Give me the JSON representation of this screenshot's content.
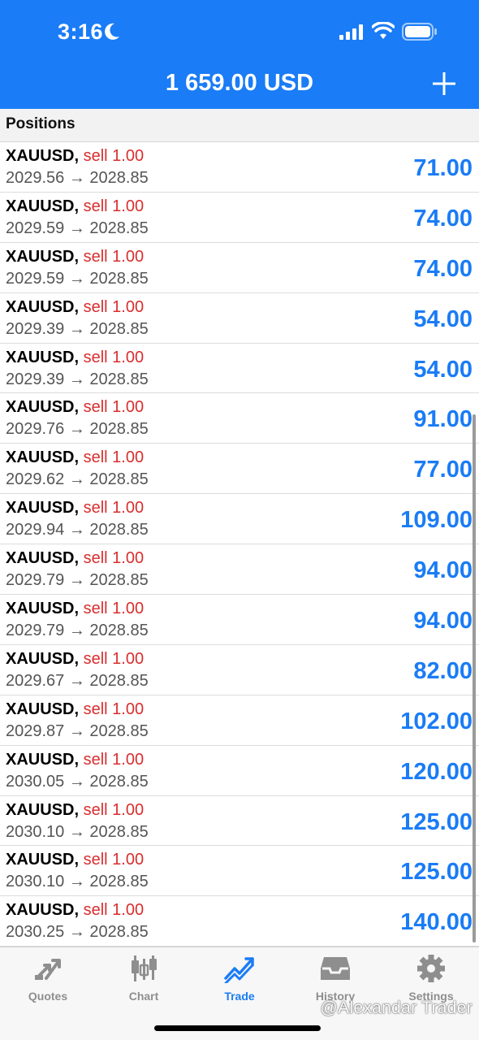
{
  "status_bar": {
    "time": "3:16"
  },
  "header": {
    "balance": "1 659.00 USD"
  },
  "section": {
    "title": "Positions"
  },
  "positions": [
    {
      "symbol": "XAUUSD,",
      "direction": "sell 1.00",
      "open_price": "2029.56",
      "current_price": "2028.85",
      "profit": "71.00"
    },
    {
      "symbol": "XAUUSD,",
      "direction": "sell 1.00",
      "open_price": "2029.59",
      "current_price": "2028.85",
      "profit": "74.00"
    },
    {
      "symbol": "XAUUSD,",
      "direction": "sell 1.00",
      "open_price": "2029.59",
      "current_price": "2028.85",
      "profit": "74.00"
    },
    {
      "symbol": "XAUUSD,",
      "direction": "sell 1.00",
      "open_price": "2029.39",
      "current_price": "2028.85",
      "profit": "54.00"
    },
    {
      "symbol": "XAUUSD,",
      "direction": "sell 1.00",
      "open_price": "2029.39",
      "current_price": "2028.85",
      "profit": "54.00"
    },
    {
      "symbol": "XAUUSD,",
      "direction": "sell 1.00",
      "open_price": "2029.76",
      "current_price": "2028.85",
      "profit": "91.00"
    },
    {
      "symbol": "XAUUSD,",
      "direction": "sell 1.00",
      "open_price": "2029.62",
      "current_price": "2028.85",
      "profit": "77.00"
    },
    {
      "symbol": "XAUUSD,",
      "direction": "sell 1.00",
      "open_price": "2029.94",
      "current_price": "2028.85",
      "profit": "109.00"
    },
    {
      "symbol": "XAUUSD,",
      "direction": "sell 1.00",
      "open_price": "2029.79",
      "current_price": "2028.85",
      "profit": "94.00"
    },
    {
      "symbol": "XAUUSD,",
      "direction": "sell 1.00",
      "open_price": "2029.79",
      "current_price": "2028.85",
      "profit": "94.00"
    },
    {
      "symbol": "XAUUSD,",
      "direction": "sell 1.00",
      "open_price": "2029.67",
      "current_price": "2028.85",
      "profit": "82.00"
    },
    {
      "symbol": "XAUUSD,",
      "direction": "sell 1.00",
      "open_price": "2029.87",
      "current_price": "2028.85",
      "profit": "102.00"
    },
    {
      "symbol": "XAUUSD,",
      "direction": "sell 1.00",
      "open_price": "2030.05",
      "current_price": "2028.85",
      "profit": "120.00"
    },
    {
      "symbol": "XAUUSD,",
      "direction": "sell 1.00",
      "open_price": "2030.10",
      "current_price": "2028.85",
      "profit": "125.00"
    },
    {
      "symbol": "XAUUSD,",
      "direction": "sell 1.00",
      "open_price": "2030.10",
      "current_price": "2028.85",
      "profit": "125.00"
    },
    {
      "symbol": "XAUUSD,",
      "direction": "sell 1.00",
      "open_price": "2030.25",
      "current_price": "2028.85",
      "profit": "140.00"
    }
  ],
  "arrow": "→",
  "tabs": [
    {
      "label": "Quotes",
      "icon": "quotes-icon",
      "active": false
    },
    {
      "label": "Chart",
      "icon": "chart-icon",
      "active": false
    },
    {
      "label": "Trade",
      "icon": "trade-icon",
      "active": true
    },
    {
      "label": "History",
      "icon": "history-icon",
      "active": false
    },
    {
      "label": "Settings",
      "icon": "settings-icon",
      "active": false
    }
  ],
  "watermark": "@Alexandar Trader",
  "colors": {
    "accent": "#1a7cf6",
    "sell": "#d92e2e",
    "inactive_tab": "#8e8e8e"
  }
}
